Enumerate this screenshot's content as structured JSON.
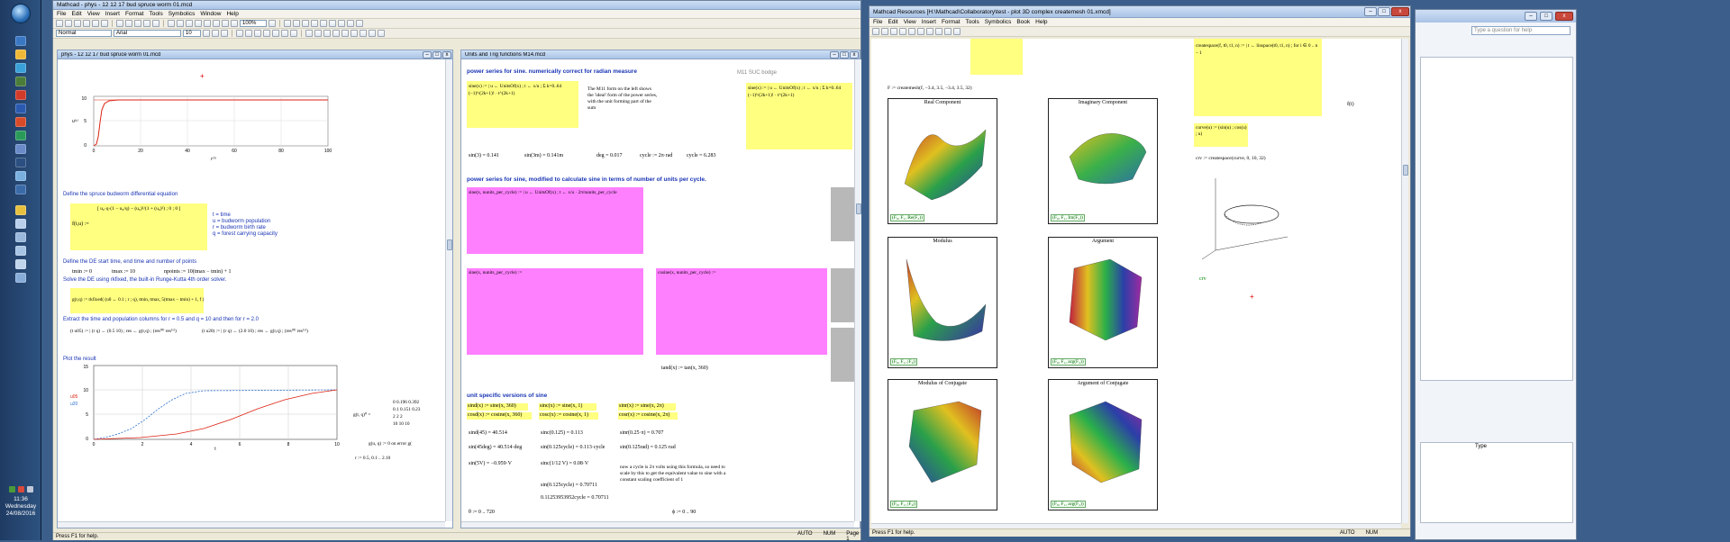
{
  "taskbar": {
    "time": "11:36",
    "day": "Wednesday",
    "date": "24/08/2016"
  },
  "mathcad_main": {
    "title": "Mathcad - phys - 12 12 17 bud spruce worm 01.mcd",
    "menus": [
      "File",
      "Edit",
      "View",
      "Insert",
      "Format",
      "Tools",
      "Symbolics",
      "Window",
      "Help"
    ],
    "style_combo": "Normal",
    "font_combo": "Arial",
    "size_combo": "10",
    "zoom_combo": "100%",
    "status_left": "Press F1 for help.",
    "status_auto": "AUTO",
    "status_num": "NUM",
    "status_page": "Page 1"
  },
  "doc1": {
    "title": "phys - 12 12 17 bud spruce worm 01.mcd",
    "plot1_yticks": [
      "10",
      "5",
      "0"
    ],
    "plot1_xticks": [
      "0",
      "20",
      "40",
      "60",
      "80",
      "100"
    ],
    "plot1_xlabel": "t⁽⁰⁾",
    "plot1_ylabel": "u⁽¹⁾",
    "h_define": "Define the spruce budworm differential equation",
    "fx_lhs": "f(t,u) :=",
    "fx_body": "[ u₀·q·(1 − u₀/q) − (u₀)²/(1 + (u₀)²) ; 0 ; 0 ]",
    "legend": [
      "t = time",
      "u = budworm population",
      "r = budworm birth rate",
      "q = forest carrying capacity"
    ],
    "h_start": "Define the DE start time, end time and number of points",
    "tmin": "tmin := 0",
    "tmax": "tmax := 10",
    "npoints": "npoints := 10(tmax − tmin) + 1",
    "h_solve": "Solve the DE using rkfixed, the built-in Runge-Kutta 4th order solver.",
    "rk_expr": "g(r,q) := rkfixed( (u0 ← 0.1 ; r ; q), tmin, tmax, 5(tmax − tmin) + 1, f )",
    "h_extract": "Extract the time and population columns for r = 0.5 and q = 10 and then for r = 2.0",
    "ext1": "(t u05) := | (r q) ← (0.5 10) ; res ← g(r,q) ; (res⁽⁰⁾ res⁽¹⁾)",
    "ext2": "(t u20) := | (r q) ← (2.0 10) ; res ← g(r,q) ; (res⁽⁰⁾ res⁽¹⁾)",
    "h_plot": "Plot the result",
    "plot2_yticks": [
      "15",
      "10",
      "5",
      "0"
    ],
    "plot2_xticks": [
      "0",
      "2",
      "4",
      "6",
      "8",
      "10"
    ],
    "plot2_ylab1": "u05",
    "plot2_ylab2": "u20",
    "plot2_xlabel": "t",
    "matrix_lhs": "g(t, q)⁰ =",
    "matrix_rows": [
      "0   0.196  0.392",
      "0.1  0.151  0.23",
      "2    2    2",
      "10   10   10"
    ],
    "gu_expr": "g(u, q) := 0  on error g(",
    "r_expr": "r := 0.5, 0.1 .. 2.10"
  },
  "doc2": {
    "title": "Units and Trig functions M14.mcd",
    "h1": "power series for sine.  numerically correct for radian measure",
    "m11_label": "M11 SUC bodge",
    "sine_def1": "sine(x) := | u ← UnitsOf(x) ; t ← x/u ; Σ k=0..64 (−1)ᵏ/(2k+1)! · t^(2k+1)",
    "note1": "The M11 form on the left shows the 'ideal' form of the power series, with the unit forming part of the sum",
    "sin3": "sin(3) = 0.141",
    "sin3m": "sin(3m) = 0.141m",
    "deg": "deg = 0.017",
    "cycle": "cycle := 2π·rad",
    "cycle_val": "cycle = 6.283",
    "h2": "power series for sine, modified to calculate sine in terms of number of units per cycle.",
    "sine_def2": "sine(x, nunits_per_cycle) := | u ← UnitsOf(x) ; t ← x/u · 2π/nunits_per_cycle",
    "sine_def3": "sine(x, nunits_per_cycle) :=",
    "cosine_def": "cosine(x, nunits_per_cycle) :=",
    "tand": "tand(x) := tan(x, 360)",
    "h3": "unit specific versions of sine",
    "sind": "sind(x) := sine(x, 360)",
    "cosd": "cosd(x) := cosine(x, 360)",
    "sinc": "sinc(x) := sine(x, 1)",
    "cosc": "cosc(x) := cosine(x, 1)",
    "sinr": "sinr(x) := sine(x, 2π)",
    "cosr": "cosr(x) := cosine(x, 2π)",
    "sind45": "sind(45) = 40.514",
    "sin45deg": "sin(45deg) = 40.514·deg",
    "sinc0125": "sinc(0.125) = 0.113",
    "sin0125cycle": "sin(0.125cycle) = 0.113·cycle",
    "sinr025": "sinr(0.25·π) = 0.707",
    "sin0125rad": "sin(0.125rad) = 0.125·rad",
    "sin5V": "sin(5V) = −0.959·V",
    "sinc_frac": "sinc(1/12 V) = 0.08·V",
    "note2": "now a cycle is 2π volts using this formula, so need to scale by this to get the equivalent value to sine with a constant scaling coefficient of 1",
    "sin0125c": "sin(0.125cycle) = 0.70711",
    "long_val": "0.11253953952cycle = 0.70711",
    "theta_range": "θ := 0 .. 720",
    "phi_range": "ϕ := 0 .. 90"
  },
  "resources": {
    "title": "Mathcad Resources [H:\\Mathcad\\Collaboratory\\test - plot 3D complex createmesh 01.xmcd]",
    "menus": [
      "File",
      "Edit",
      "View",
      "Insert",
      "Format",
      "Tools",
      "Symbolics",
      "Book",
      "Help"
    ],
    "F_def": "F := createmesh(f, −3.4, 3.5, −3.4, 3.5, 32)",
    "createspace": "createspace(f, t0, t1, n) := | t ← linspace(t0, t1, n) ; for i ∈ 0 .. n − 1",
    "curve_def": "curve(u) := (sin(u) ; cos(u) ; u)",
    "crv_def": "crv := createspace(curve, 0, 10, 32)",
    "f_of_t": "f(t)",
    "crv_label": "crv",
    "plots": [
      {
        "title": "Real Component",
        "label": "(F₀, F₁, Re(F₂))"
      },
      {
        "title": "Imaginary Component",
        "label": "(F₀, F₁, Im(F₂))"
      },
      {
        "title": "Modulus",
        "label": "(F₀, F₁, |F₂|)"
      },
      {
        "title": "Argument",
        "label": "(F₀, F₁, arg(F₂))"
      },
      {
        "title": "Modulus of Conjugate",
        "label": "(F₀, F₁, |F̄₂|)"
      },
      {
        "title": "Argument of Conjugate",
        "label": "(F₀, F₁, arg(F̄₂))"
      }
    ],
    "status_left": "Press F1 for help.",
    "status_auto": "AUTO",
    "status_num": "NUM"
  },
  "bg_window": {
    "search_placeholder": "Type a question for help",
    "type_col": "Type"
  }
}
